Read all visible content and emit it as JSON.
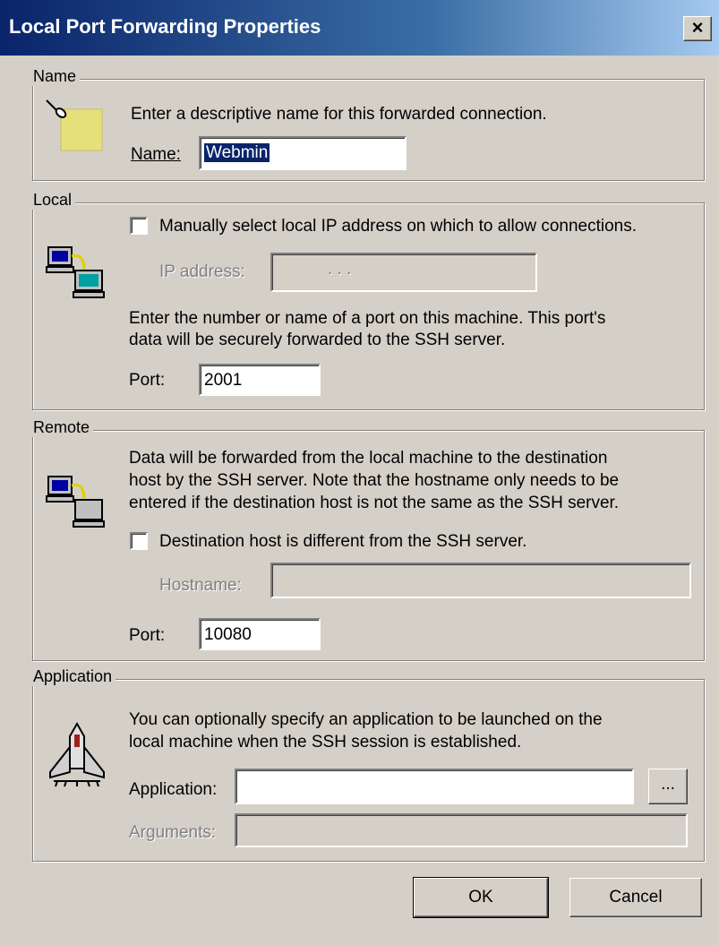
{
  "window": {
    "title": "Local Port Forwarding Properties",
    "close_label": "×"
  },
  "name_group": {
    "legend": "Name",
    "description": "Enter a descriptive name for this forwarded connection.",
    "name_label": "Name:",
    "name_value": "Webmin",
    "icon": "pushpin-note-icon"
  },
  "local_group": {
    "legend": "Local",
    "manual_ip_label": "Manually select local IP address on which to allow connections.",
    "manual_ip_checked": false,
    "ip_label": "IP address:",
    "ip_value": ".     .     .",
    "description_line1": "Enter the number or name of a port on this machine.  This port's",
    "description_line2": "data will be securely forwarded to the SSH server.",
    "port_label": "Port:",
    "port_value": "2001",
    "icon": "networked-computers-icon"
  },
  "remote_group": {
    "legend": "Remote",
    "description_line1": "Data will be forwarded from the local machine to the destination",
    "description_line2": "host by the SSH server.  Note that the hostname only needs to be",
    "description_line3": "entered if the destination host is not the same as the SSH server.",
    "dest_label": "Destination host is different from the SSH server.",
    "dest_checked": false,
    "hostname_label": "Hostname:",
    "hostname_value": "",
    "port_label": "Port:",
    "port_value": "10080",
    "icon": "networked-computers-icon"
  },
  "application_group": {
    "legend": "Application",
    "description_line1": "You can optionally specify an application to be launched on the",
    "description_line2": "local machine when the SSH session is established.",
    "application_label": "Application:",
    "application_value": "",
    "browse_label": "...",
    "arguments_label": "Arguments:",
    "arguments_value": "",
    "icon": "space-shuttle-icon"
  },
  "buttons": {
    "ok": "OK",
    "cancel": "Cancel"
  }
}
